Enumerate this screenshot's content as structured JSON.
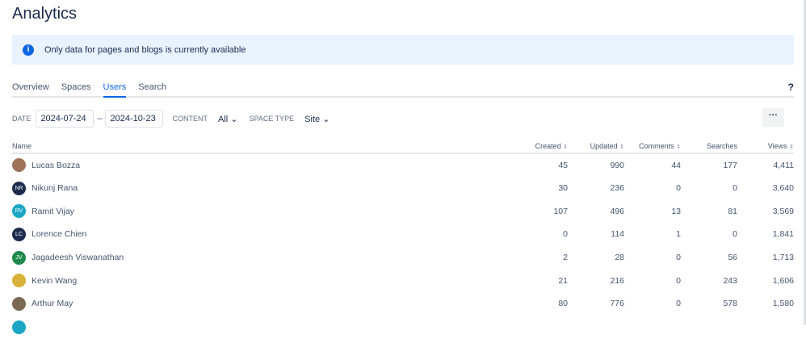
{
  "title": "Analytics",
  "banner": {
    "icon": "info-icon",
    "text": "Only data for pages and blogs is currently available"
  },
  "tabs": [
    "Overview",
    "Spaces",
    "Users",
    "Search"
  ],
  "active_tab": "Users",
  "help": "?",
  "filters": {
    "date_label": "DATE",
    "start": "2024-07-24",
    "sep": "–",
    "end": "2024-10-23",
    "content_label": "CONTENT",
    "content_value": "All",
    "space_type_label": "SPACE TYPE",
    "space_type_value": "Site",
    "more": "···"
  },
  "columns": [
    "Name",
    "Created",
    "Updated",
    "Comments",
    "Searches",
    "Views"
  ],
  "sort_glyph": "⇕",
  "rows": [
    {
      "name": "Lucas Bozza",
      "initials": "",
      "color": "#a0725a",
      "created": "45",
      "updated": "990",
      "comments": "44",
      "searches": "177",
      "views": "4,411"
    },
    {
      "name": "Nikunj Rana",
      "initials": "NR",
      "color": "#1d2b4f",
      "created": "30",
      "updated": "236",
      "comments": "0",
      "searches": "0",
      "views": "3,640"
    },
    {
      "name": "Ramit Vijay",
      "initials": "RV",
      "color": "#1aa6c4",
      "created": "107",
      "updated": "496",
      "comments": "13",
      "searches": "81",
      "views": "3,569"
    },
    {
      "name": "Lorence Chien",
      "initials": "LC",
      "color": "#1d2b4f",
      "created": "0",
      "updated": "114",
      "comments": "1",
      "searches": "0",
      "views": "1,841"
    },
    {
      "name": "Jagadeesh Viswanathan",
      "initials": "JV",
      "color": "#1f8a4c",
      "created": "2",
      "updated": "28",
      "comments": "0",
      "searches": "56",
      "views": "1,713"
    },
    {
      "name": "Kevin Wang",
      "initials": "",
      "color": "#d9b23a",
      "created": "21",
      "updated": "216",
      "comments": "0",
      "searches": "243",
      "views": "1,606"
    },
    {
      "name": "Arthur May",
      "initials": "",
      "color": "#7a6a52",
      "created": "80",
      "updated": "776",
      "comments": "0",
      "searches": "578",
      "views": "1,580"
    }
  ]
}
